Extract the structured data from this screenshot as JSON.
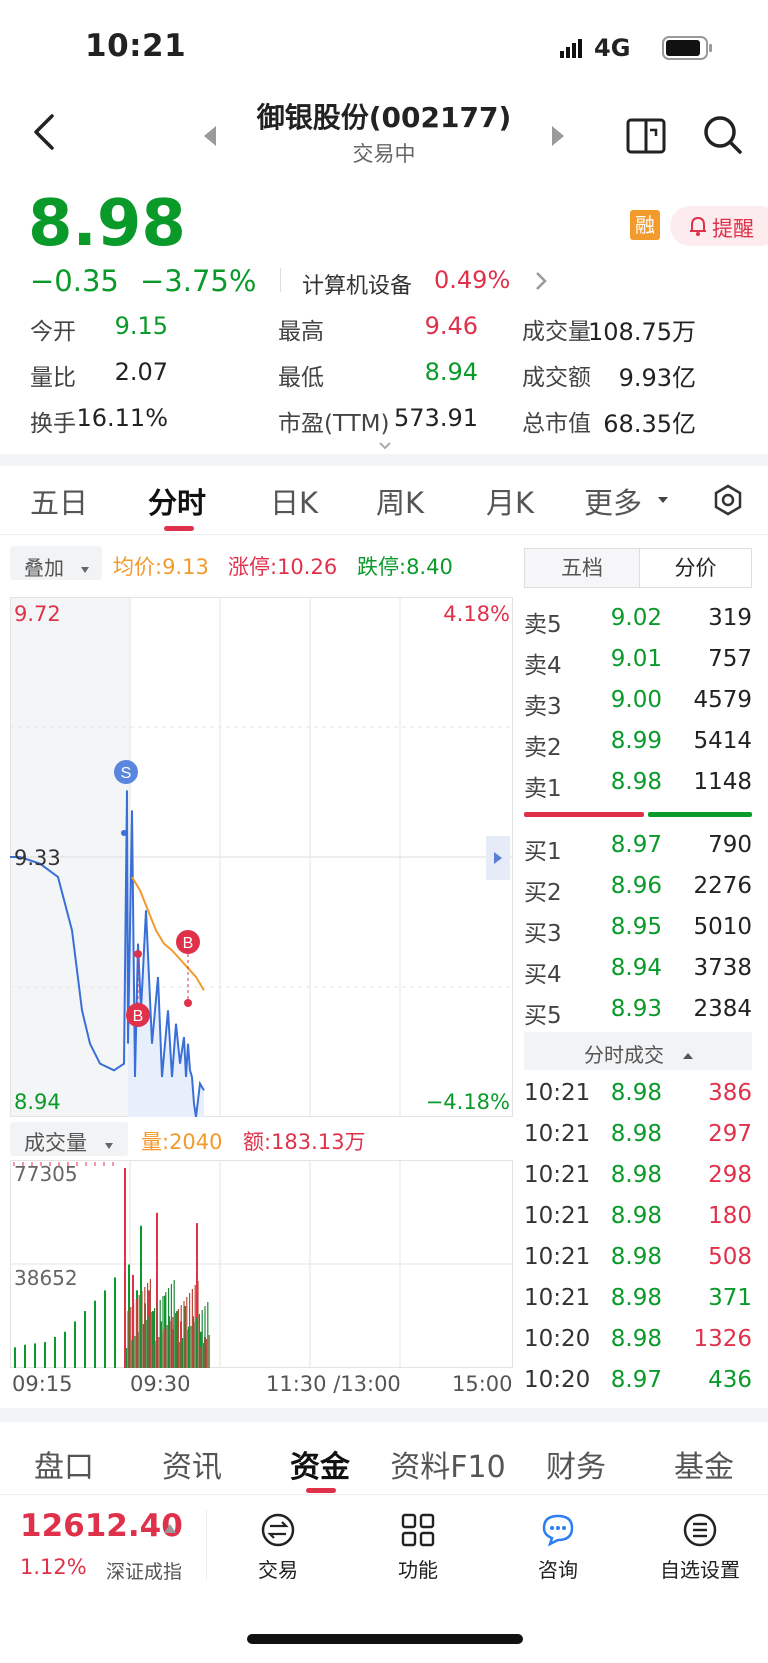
{
  "status": {
    "time": "10:21",
    "network": "4G"
  },
  "nav": {
    "title": "御银股份(002177)",
    "subtitle": "交易中"
  },
  "quote": {
    "price": "8.98",
    "change": "−0.35",
    "change_pct": "−3.75%",
    "sector": "计算机设备",
    "sector_pct": "0.49%",
    "rong_badge": "融",
    "remind_label": "提醒"
  },
  "stats": [
    {
      "label": "今开",
      "value": "9.15",
      "color": "green"
    },
    {
      "label": "最高",
      "value": "9.46",
      "color": "red"
    },
    {
      "label": "成交量",
      "value": "108.75万",
      "color": "dark"
    },
    {
      "label": "量比",
      "value": "2.07",
      "color": "dark"
    },
    {
      "label": "最低",
      "value": "8.94",
      "color": "green"
    },
    {
      "label": "成交额",
      "value": "9.93亿",
      "color": "dark"
    },
    {
      "label": "换手",
      "value": "16.11%",
      "color": "dark"
    },
    {
      "label": "市盈(TTM)",
      "value": "573.91",
      "color": "dark"
    },
    {
      "label": "总市值",
      "value": "68.35亿",
      "color": "dark"
    }
  ],
  "chart_tabs": [
    "五日",
    "分时",
    "日K",
    "周K",
    "月K",
    "更多"
  ],
  "chart_tab_active": "分时",
  "overlay": {
    "label": "叠加",
    "avg": "均价:9.13",
    "limit_up": "涨停:10.26",
    "limit_down": "跌停:8.40"
  },
  "orderbook_tabs": [
    "五档",
    "分价"
  ],
  "sells": [
    {
      "label": "卖5",
      "price": "9.02",
      "vol": "319"
    },
    {
      "label": "卖4",
      "price": "9.01",
      "vol": "757"
    },
    {
      "label": "卖3",
      "price": "9.00",
      "vol": "4579"
    },
    {
      "label": "卖2",
      "price": "8.99",
      "vol": "5414"
    },
    {
      "label": "卖1",
      "price": "8.98",
      "vol": "1148"
    }
  ],
  "buys": [
    {
      "label": "买1",
      "price": "8.97",
      "vol": "790"
    },
    {
      "label": "买2",
      "price": "8.96",
      "vol": "2276"
    },
    {
      "label": "买3",
      "price": "8.95",
      "vol": "5010"
    },
    {
      "label": "买4",
      "price": "8.94",
      "vol": "3738"
    },
    {
      "label": "买5",
      "price": "8.93",
      "vol": "2384"
    }
  ],
  "trades_header": "分时成交",
  "trades": [
    {
      "time": "10:21",
      "price": "8.98",
      "vol": "386",
      "color": "red"
    },
    {
      "time": "10:21",
      "price": "8.98",
      "vol": "297",
      "color": "red"
    },
    {
      "time": "10:21",
      "price": "8.98",
      "vol": "298",
      "color": "red"
    },
    {
      "time": "10:21",
      "price": "8.98",
      "vol": "180",
      "color": "red"
    },
    {
      "time": "10:21",
      "price": "8.98",
      "vol": "508",
      "color": "red"
    },
    {
      "time": "10:21",
      "price": "8.98",
      "vol": "371",
      "color": "green"
    },
    {
      "time": "10:20",
      "price": "8.98",
      "vol": "1326",
      "color": "red"
    },
    {
      "time": "10:20",
      "price": "8.97",
      "vol": "436",
      "color": "green"
    }
  ],
  "chart_data": {
    "type": "line",
    "y_top": "9.72",
    "y_mid": "9.33",
    "y_bot": "8.94",
    "pct_top": "4.18%",
    "pct_bot": "−4.18%",
    "ylim": [
      8.94,
      9.72
    ],
    "price_series": [
      9.33,
      9.33,
      9.32,
      9.3,
      9.22,
      9.1,
      9.05,
      9.02,
      9.01,
      9.02,
      9.43,
      9.05,
      9.4,
      9.0,
      9.2,
      9.1,
      9.25,
      9.05,
      9.15,
      9.0,
      9.1,
      9.0,
      9.08,
      9.02,
      9.06,
      9.0,
      9.05,
      9.01,
      9.0,
      8.96,
      8.94,
      8.99,
      8.98
    ],
    "avg_series": [
      9.3,
      9.28,
      9.25,
      9.22,
      9.2,
      9.19,
      9.18,
      9.17,
      9.16,
      9.15,
      9.13
    ],
    "markers": [
      "S",
      "B",
      "B"
    ],
    "volume_label": "成交量",
    "volume_now": "量:2040",
    "amount_now": "额:183.13万",
    "vol_top": "77305",
    "vol_mid": "38652",
    "volume_series": [
      8000,
      9000,
      9500,
      10000,
      12000,
      14000,
      18000,
      22000,
      26000,
      30000,
      35000,
      77305,
      40000,
      36000,
      30000,
      55000,
      25000,
      30000,
      22000,
      60000,
      18000,
      28000,
      20000,
      15000,
      22000,
      18000,
      24000,
      16000,
      20000,
      56000,
      14000,
      12000
    ],
    "x_labels": [
      "09:15",
      "09:30",
      "11:30 /13:00",
      "15:00"
    ]
  },
  "bottom_tabs": [
    "盘口",
    "资讯",
    "资金",
    "资料F10",
    "财务",
    "基金"
  ],
  "bottom_tab_active": "资金",
  "index": {
    "value": "12612.40",
    "pct": "1.12%",
    "name": "深证成指"
  },
  "toolbar": [
    {
      "label": "交易",
      "icon": "exchange-icon"
    },
    {
      "label": "功能",
      "icon": "grid-icon"
    },
    {
      "label": "咨询",
      "icon": "chat-icon"
    },
    {
      "label": "自选设置",
      "icon": "list-icon"
    }
  ]
}
